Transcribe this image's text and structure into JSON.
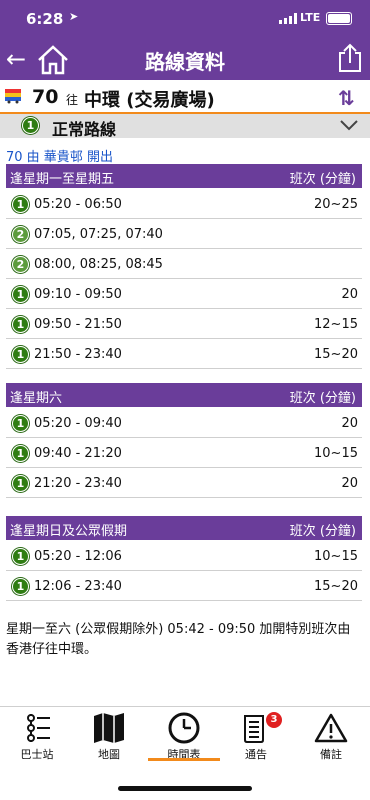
{
  "status_bar": {
    "time": "6:28",
    "network": "LTE"
  },
  "nav": {
    "title": "路線資料",
    "back_glyph": "←",
    "icons": [
      "home-icon",
      "share-icon"
    ]
  },
  "route": {
    "number": "70",
    "to_label": "往",
    "destination": "中環 (交易廣場)",
    "swap_glyph": "⇅"
  },
  "route_type": {
    "badge": "1",
    "label": "正常路線"
  },
  "origin_text": "70 由 華貴邨 開出",
  "colors": {
    "header": "#6a3d9a",
    "accent": "#f28a1b",
    "link": "#1a55c9",
    "badge_green": "#2f7d12"
  },
  "sections": [
    {
      "title": "逢星期一至星期五",
      "freq_header": "班次 (分鐘)",
      "rows": [
        {
          "badge": "1",
          "time": "05:20 - 06:50",
          "freq": "20~25"
        },
        {
          "badge": "2",
          "time": "07:05, 07:25, 07:40",
          "freq": ""
        },
        {
          "badge": "2",
          "time": "08:00, 08:25, 08:45",
          "freq": ""
        },
        {
          "badge": "1",
          "time": "09:10 - 09:50",
          "freq": "20"
        },
        {
          "badge": "1",
          "time": "09:50 - 21:50",
          "freq": "12~15"
        },
        {
          "badge": "1",
          "time": "21:50 - 23:40",
          "freq": "15~20"
        }
      ]
    },
    {
      "title": "逢星期六",
      "freq_header": "班次 (分鐘)",
      "rows": [
        {
          "badge": "1",
          "time": "05:20 - 09:40",
          "freq": "20"
        },
        {
          "badge": "1",
          "time": "09:40 - 21:20",
          "freq": "10~15"
        },
        {
          "badge": "1",
          "time": "21:20 - 23:40",
          "freq": "20"
        }
      ]
    },
    {
      "title": "逢星期日及公眾假期",
      "freq_header": "班次 (分鐘)",
      "rows": [
        {
          "badge": "1",
          "time": "05:20 - 12:06",
          "freq": "10~15"
        },
        {
          "badge": "1",
          "time": "12:06 - 23:40",
          "freq": "15~20"
        }
      ]
    }
  ],
  "note": "星期一至六 (公眾假期除外) 05:42 - 09:50 加開特別班次由香港仔往中環。",
  "tabs": [
    {
      "label": "巴士站",
      "icon": "bus-stops-icon"
    },
    {
      "label": "地圖",
      "icon": "map-icon"
    },
    {
      "label": "時間表",
      "icon": "clock-icon",
      "active": true
    },
    {
      "label": "通告",
      "icon": "notice-icon",
      "badge": "3"
    },
    {
      "label": "備註",
      "icon": "warning-icon"
    }
  ]
}
